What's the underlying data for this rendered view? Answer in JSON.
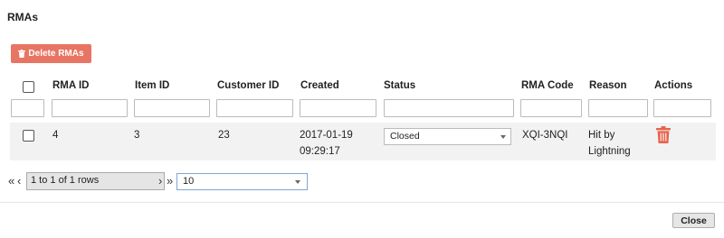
{
  "dialog": {
    "title": "RMAs",
    "close_label": "Close"
  },
  "toolbar": {
    "delete_label": "Delete RMAs",
    "delete_icon": "trash-icon"
  },
  "table": {
    "headers": [
      "RMA ID",
      "Item ID",
      "Customer ID",
      "Created",
      "Status",
      "RMA Code",
      "Reason",
      "Actions"
    ],
    "rows": [
      {
        "rma_id": "4",
        "item_id": "3",
        "customer_id": "23",
        "created_date": "2017-01-19",
        "created_time": "09:29:17",
        "status": "Closed",
        "rma_code": "XQI-3NQI",
        "reason_line1": "Hit by",
        "reason_line2": "Lightning",
        "action_icon": "trash-icon"
      }
    ]
  },
  "pager": {
    "first_icon": "«",
    "prev_icon": "‹",
    "info": "1 to 1 of 1 rows",
    "next_icon": "›",
    "last_icon": "»",
    "page_size": "10"
  },
  "colors": {
    "delete_button": "#e87563",
    "trash_icon": "#e8624b",
    "row_background": "#f2f2f2"
  }
}
